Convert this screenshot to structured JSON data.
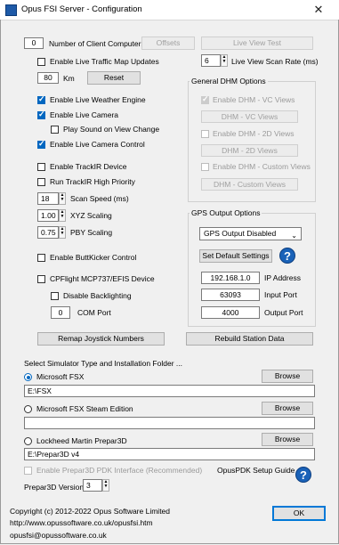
{
  "window": {
    "title": "Opus FSI Server - Configuration",
    "close_glyph": "✕"
  },
  "left": {
    "client_count": "0",
    "client_count_label": "Number of Client Computers",
    "offsets_button": "Offsets",
    "live_traffic_label": "Enable Live Traffic Map Updates",
    "km_value": "80",
    "km_label": "Km",
    "reset_button": "Reset",
    "live_weather_label": "Enable Live Weather Engine",
    "live_camera_label": "Enable Live Camera",
    "play_sound_label": "Play Sound on View Change",
    "camera_control_label": "Enable Live Camera Control",
    "trackir_label": "Enable TrackIR Device",
    "trackir_priority_label": "Run TrackIR High Priority",
    "scan_speed_value": "18",
    "scan_speed_label": "Scan Speed (ms)",
    "xyz_value": "1.00",
    "xyz_label": "XYZ Scaling",
    "pby_value": "0.75",
    "pby_label": "PBY Scaling",
    "buttkicker_label": "Enable ButtKicker Control",
    "cpflight_label": "CPFlight MCP737/EFIS Device",
    "backlighting_label": "Disable Backlighting",
    "com_value": "0",
    "com_label": "COM Port"
  },
  "right": {
    "live_view_test_button": "Live View Test",
    "scan_rate_value": "6",
    "scan_rate_label": "Live View Scan Rate (ms)",
    "dhm_title": "General DHM Options",
    "dhm_vc_label": "Enable DHM - VC Views",
    "dhm_vc_button": "DHM - VC Views",
    "dhm_2d_label": "Enable DHM - 2D Views",
    "dhm_2d_button": "DHM - 2D Views",
    "dhm_custom_label": "Enable DHM - Custom Views",
    "dhm_custom_button": "DHM - Custom Views",
    "gps_title": "GPS Output Options",
    "gps_select": "GPS Output Disabled",
    "default_settings_button": "Set Default Settings",
    "ip_value": "192.168.1.0",
    "ip_label": "IP Address",
    "input_port_value": "63093",
    "input_port_label": "Input Port",
    "output_port_value": "4000",
    "output_port_label": "Output Port"
  },
  "actions": {
    "remap_button": "Remap Joystick Numbers",
    "rebuild_button": "Rebuild Station Data"
  },
  "sim": {
    "heading": "Select Simulator Type and Installation Folder ...",
    "fsx_label": "Microsoft FSX",
    "fsx_path": "E:\\FSX",
    "fsx_steam_label": "Microsoft FSX Steam Edition",
    "fsx_steam_path": "",
    "p3d_label": "Lockheed Martin Prepar3D",
    "p3d_path": "E:\\Prepar3D v4",
    "browse_button": "Browse",
    "pdk_label": "Enable Prepar3D PDK Interface (Recommended)",
    "pdk_guide_label": "OpusPDK Setup Guide",
    "p3d_version_label": "Prepar3D Version",
    "p3d_version_value": "3"
  },
  "footer": {
    "copyright": "Copyright (c)  2012-2022 Opus Software Limited",
    "url": "http://www.opussoftware.co.uk/opusfsi.htm",
    "email": "opusfsi@opussoftware.co.uk",
    "ok_button": "OK"
  },
  "help_glyph": "?"
}
